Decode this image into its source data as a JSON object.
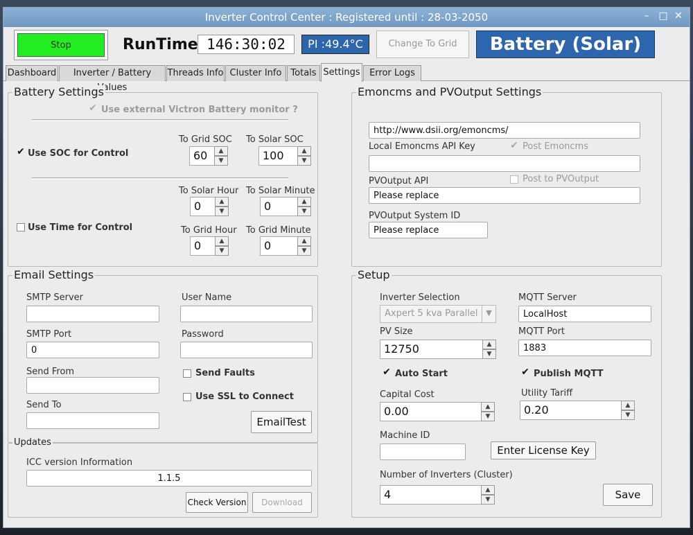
{
  "window": {
    "title": "Inverter Control Center : Registered until : 28-03-2050",
    "minimize": "–",
    "maximize": "□",
    "close": "✕"
  },
  "toolbar": {
    "stop_label": "Stop",
    "runtime_label": "RunTime",
    "runtime_value": "146:30:02",
    "pi_temp": "PI :49.4°C",
    "change_grid_label": "Change To Grid",
    "mode_banner": "Battery (Solar)"
  },
  "tabs": [
    {
      "label": "Dashboard",
      "active": false
    },
    {
      "label": "Inverter / Battery Values",
      "active": false
    },
    {
      "label": "Threads Info",
      "active": false
    },
    {
      "label": "Cluster Info",
      "active": false
    },
    {
      "label": "Totals",
      "active": false
    },
    {
      "label": "Settings",
      "active": true
    },
    {
      "label": "Error Logs",
      "active": false
    }
  ],
  "battery": {
    "title": "Battery Settings",
    "victron_label": "Use external Victron Battery monitor ?",
    "use_soc_label": "Use SOC for Control",
    "to_grid_soc_label": "To Grid SOC",
    "to_grid_soc": "60",
    "to_solar_soc_label": "To Solar SOC",
    "to_solar_soc": "100",
    "use_time_label": "Use Time for Control",
    "to_solar_hour_label": "To Solar Hour",
    "to_solar_hour": "0",
    "to_solar_minute_label": "To Solar Minute",
    "to_solar_minute": "0",
    "to_grid_hour_label": "To Grid Hour",
    "to_grid_hour": "0",
    "to_grid_minute_label": "To Grid Minute",
    "to_grid_minute": "0"
  },
  "email": {
    "title": "Email Settings",
    "smtp_server_label": "SMTP Server",
    "smtp_server": "",
    "user_name_label": "User Name",
    "user_name": "",
    "smtp_port_label": "SMTP Port",
    "smtp_port": "0",
    "password_label": "Password",
    "password": "",
    "send_from_label": "Send From",
    "send_from": "",
    "send_faults_label": "Send Faults",
    "send_to_label": "Send To",
    "send_to": "",
    "use_ssl_label": "Use SSL to Connect",
    "email_test_label": "EmailTest"
  },
  "updates": {
    "title": "Updates",
    "version_info_label": "ICC version Information",
    "version": "1.1.5",
    "check_version_label": "Check Version",
    "download_label": "Download"
  },
  "emon": {
    "title": "Emoncms and PVOutput Settings",
    "url": "http://www.dsii.org/emoncms/",
    "api_key_label": "Local Emoncms API Key",
    "post_emoncms_label": "Post Emoncms",
    "api_key": "",
    "pvoutput_api_label": "PVOutput API",
    "post_pvoutput_label": "Post to PVOutput",
    "pvoutput_api": "Please replace",
    "pvoutput_system_label": "PVOutput System ID",
    "pvoutput_system": "Please replace"
  },
  "setup": {
    "title": "Setup",
    "inverter_selection_label": "Inverter Selection",
    "inverter_selection": "Axpert 5 kva Parallel",
    "mqtt_server_label": "MQTT Server",
    "mqtt_server": "LocalHost",
    "pv_size_label": "PV Size",
    "pv_size": "12750",
    "mqtt_port_label": "MQTT Port",
    "mqtt_port": "1883",
    "auto_start_label": "Auto Start",
    "publish_mqtt_label": "Publish MQTT",
    "capital_cost_label": "Capital  Cost",
    "capital_cost": "0.00",
    "utility_tariff_label": "Utility Tariff",
    "utility_tariff": "0.20",
    "machine_id_label": "Machine ID",
    "machine_id": "",
    "license_key_label": "Enter License Key",
    "num_inverters_label": "Number of Inverters (Cluster)",
    "num_inverters": "4",
    "save_label": "Save"
  },
  "colors": {
    "stop_green": "#22ee22",
    "accent_blue": "#2d66ad",
    "titlebar": "#7aa2cc"
  }
}
